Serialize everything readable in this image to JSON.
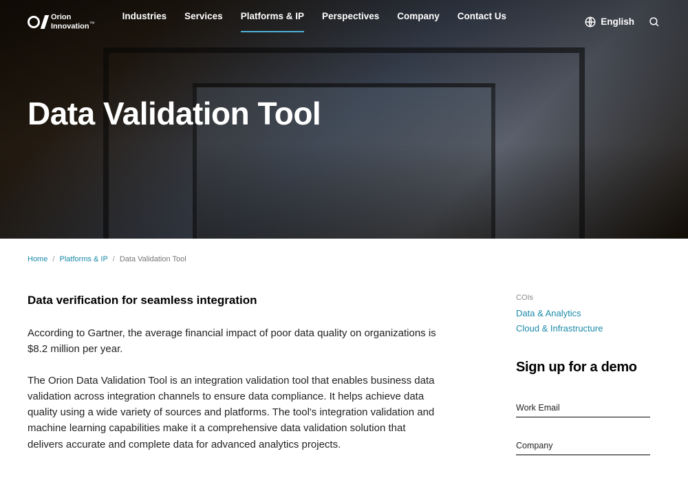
{
  "brand": {
    "name_line1": "Orion",
    "name_line2": "Innovation",
    "tm": "™"
  },
  "nav": {
    "items": [
      {
        "label": "Industries"
      },
      {
        "label": "Services"
      },
      {
        "label": "Platforms & IP",
        "active": true
      },
      {
        "label": "Perspectives"
      },
      {
        "label": "Company"
      },
      {
        "label": "Contact Us"
      }
    ],
    "language": "English"
  },
  "hero": {
    "title": "Data Validation Tool"
  },
  "breadcrumb": {
    "home": "Home",
    "section": "Platforms & IP",
    "current": "Data Validation Tool",
    "sep": "/"
  },
  "article": {
    "subheading": "Data verification for seamless integration",
    "p1": "According to Gartner, the average financial impact of poor data quality on organizations is $8.2 million per year.",
    "p2": "The Orion Data Validation Tool is an integration validation tool that enables business data validation across integration channels to ensure data compliance. It helps achieve data quality using a wide variety of sources and platforms. The tool's integration validation and machine learning capabilities make it a comprehensive data validation solution that delivers accurate and complete data for advanced analytics projects."
  },
  "sidebar": {
    "coi_label": "COIs",
    "coi_links": [
      {
        "label": "Data & Analytics"
      },
      {
        "label": "Cloud & Infrastructure"
      }
    ],
    "demo_heading": "Sign up for a demo",
    "fields": {
      "email_placeholder": "Work Email",
      "company_placeholder": "Company"
    }
  }
}
